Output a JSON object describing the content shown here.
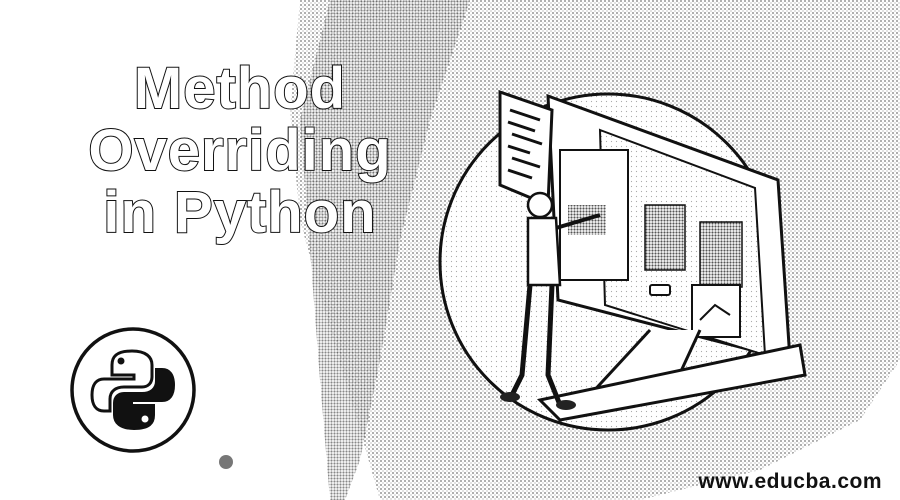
{
  "banner": {
    "title_lines": [
      "Method",
      "Overriding",
      "in Python"
    ],
    "website": "www.educba.com",
    "logo_icon": "python-logo-icon",
    "illustration": "person-with-code-panels-illustration"
  },
  "colors": {
    "background": "#ffffff",
    "ink": "#111111",
    "stipple": "#8a8a8a"
  }
}
